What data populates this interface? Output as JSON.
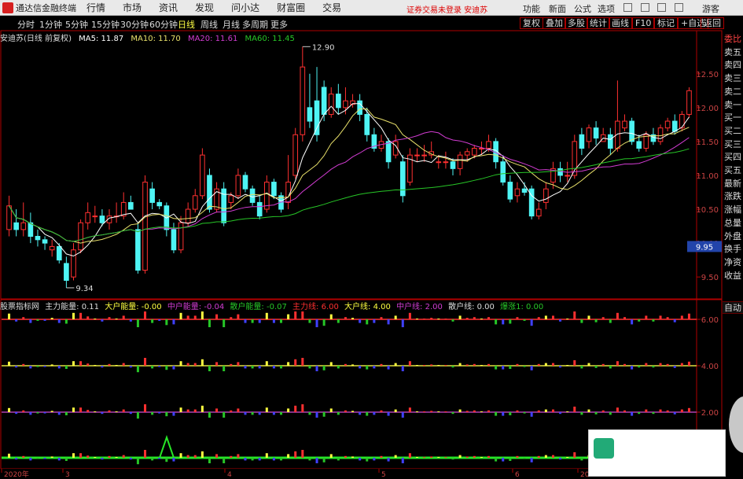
{
  "titlebar": {
    "app_name": "通达信金融终端",
    "menus": [
      "行情",
      "市场",
      "资讯",
      "发现",
      "问小达",
      "财富圈",
      "交易"
    ],
    "warning": "证券交易未登录 安迪苏",
    "right": [
      "功能",
      "新面",
      "公式",
      "选项"
    ],
    "guest": "游客"
  },
  "toolbar": {
    "periods": [
      "分时",
      "1分钟",
      "5分钟",
      "15分钟",
      "30分钟",
      "60分钟",
      "日线",
      "周线",
      "月线",
      "多周期",
      "更多"
    ],
    "active_period": "日线",
    "right_buttons": [
      "复权",
      "叠加",
      "多股",
      "统计",
      "画线",
      "F10",
      "标记",
      "+自选",
      "返回"
    ]
  },
  "infobar": {
    "stock": "安迪苏(日线 前复权)",
    "ma5": "MA5: 11.87",
    "ma10": "MA10: 11.70",
    "ma20": "MA20: 11.61",
    "ma60": "MA60: 11.45"
  },
  "colors": {
    "ma5": "#ffffff",
    "ma10": "#e8e06a",
    "ma20": "#d23cd2",
    "ma60": "#27c627",
    "up": "#ff3030",
    "down": "#4ef4f4",
    "frame": "#b00000"
  },
  "price_axis": {
    "ticks": [
      "12.50",
      "12.00",
      "11.50",
      "11.00",
      "10.50",
      "10.00",
      "9.50"
    ],
    "current": "9.95"
  },
  "annotations": {
    "high": "12.90",
    "low": "9.34"
  },
  "right_panel": [
    "委比",
    "卖五",
    "卖四",
    "卖三",
    "卖二",
    "卖一",
    "买一",
    "买二",
    "买三",
    "买四",
    "买五",
    "最新",
    "涨跌",
    "涨幅",
    "总量",
    "外盘",
    "换手",
    "净资",
    "收益"
  ],
  "auto_label": "自动",
  "sub_indicator": {
    "name": "股票指标网",
    "items": [
      {
        "label": "主力能量: 0.11",
        "color": "#dddddd"
      },
      {
        "label": "大户能量: -0.00",
        "color": "#ffff40"
      },
      {
        "label": "中户能量: -0.04",
        "color": "#d23cd2"
      },
      {
        "label": "散户能量: -0.07",
        "color": "#27c627"
      },
      {
        "label": "主力线: 6.00",
        "color": "#ff3030"
      },
      {
        "label": "大户线: 4.00",
        "color": "#ffff40"
      },
      {
        "label": "中户线: 2.00",
        "color": "#d23cd2"
      },
      {
        "label": "散户线: 0.00",
        "color": "#dddddd"
      },
      {
        "label": "爆涨1: 0.00",
        "color": "#27c627"
      }
    ]
  },
  "sub_axis": [
    "6.00",
    "4.00",
    "2.00"
  ],
  "time_axis": [
    "2020年",
    "3",
    "4",
    "5",
    "6",
    "20"
  ],
  "chart_data": {
    "type": "candlestick",
    "title": "安迪苏(日线 前复权)",
    "price_range": [
      9.2,
      12.95
    ],
    "candles": [
      [
        10.2,
        10.55,
        10.1,
        10.7
      ],
      [
        10.3,
        10.2,
        10.1,
        10.5
      ],
      [
        10.2,
        10.3,
        10.1,
        10.6
      ],
      [
        10.3,
        10.1,
        10.0,
        10.45
      ],
      [
        10.1,
        10.05,
        9.95,
        10.2
      ],
      [
        10.05,
        10.0,
        9.9,
        10.1
      ],
      [
        9.9,
        9.95,
        9.8,
        10.05
      ],
      [
        9.95,
        9.75,
        9.7,
        10.0
      ],
      [
        9.7,
        9.45,
        9.34,
        9.8
      ],
      [
        9.5,
        9.9,
        9.45,
        10.0
      ],
      [
        9.9,
        10.3,
        9.85,
        10.35
      ],
      [
        10.3,
        10.45,
        10.2,
        10.6
      ],
      [
        10.4,
        10.4,
        10.3,
        10.55
      ],
      [
        10.4,
        10.3,
        10.25,
        10.5
      ],
      [
        10.3,
        10.4,
        10.2,
        10.5
      ],
      [
        10.4,
        10.4,
        10.3,
        10.6
      ],
      [
        10.4,
        10.6,
        10.35,
        10.75
      ],
      [
        10.6,
        10.5,
        10.5,
        10.7
      ],
      [
        10.2,
        9.6,
        9.55,
        10.3
      ],
      [
        9.6,
        10.9,
        9.55,
        11.0
      ],
      [
        10.8,
        10.6,
        10.5,
        10.9
      ],
      [
        10.6,
        10.55,
        10.5,
        10.65
      ],
      [
        10.55,
        10.2,
        10.1,
        10.6
      ],
      [
        10.2,
        9.9,
        9.85,
        10.3
      ],
      [
        9.9,
        10.3,
        9.85,
        10.4
      ],
      [
        10.3,
        10.5,
        10.25,
        10.6
      ],
      [
        10.5,
        10.7,
        10.45,
        10.8
      ],
      [
        10.7,
        11.3,
        10.65,
        11.4
      ],
      [
        11.0,
        10.5,
        10.45,
        11.1
      ],
      [
        10.5,
        10.8,
        10.45,
        10.9
      ],
      [
        10.8,
        10.3,
        10.25,
        10.9
      ],
      [
        10.6,
        10.7,
        10.5,
        10.75
      ],
      [
        10.7,
        11.0,
        10.65,
        11.1
      ],
      [
        11.0,
        10.8,
        10.75,
        11.05
      ],
      [
        10.8,
        10.6,
        10.55,
        10.85
      ],
      [
        10.6,
        10.4,
        10.35,
        10.7
      ],
      [
        10.5,
        10.9,
        10.45,
        11.0
      ],
      [
        10.9,
        10.7,
        10.65,
        10.95
      ],
      [
        10.7,
        10.5,
        10.45,
        10.75
      ],
      [
        10.6,
        10.9,
        10.5,
        11.3
      ],
      [
        11.0,
        11.6,
        10.95,
        11.7
      ],
      [
        11.6,
        12.6,
        11.5,
        12.9
      ],
      [
        12.0,
        11.8,
        11.7,
        12.5
      ],
      [
        12.1,
        11.6,
        11.5,
        12.6
      ],
      [
        12.3,
        11.9,
        11.8,
        12.4
      ],
      [
        11.9,
        12.2,
        11.85,
        12.3
      ],
      [
        12.2,
        12.0,
        11.9,
        12.35
      ],
      [
        12.0,
        12.1,
        11.9,
        12.3
      ],
      [
        12.05,
        12.1,
        12.0,
        12.2
      ],
      [
        12.1,
        11.9,
        11.8,
        12.2
      ],
      [
        11.9,
        11.6,
        11.5,
        12.0
      ],
      [
        11.6,
        11.4,
        11.35,
        11.7
      ],
      [
        11.4,
        11.5,
        11.35,
        11.6
      ],
      [
        11.5,
        11.2,
        11.1,
        11.55
      ],
      [
        11.3,
        11.5,
        11.25,
        11.6
      ],
      [
        11.2,
        10.7,
        10.6,
        11.3
      ],
      [
        10.9,
        11.3,
        10.85,
        11.4
      ],
      [
        11.3,
        11.3,
        11.2,
        11.4
      ],
      [
        11.3,
        11.3,
        11.2,
        11.45
      ],
      [
        11.3,
        11.35,
        11.25,
        11.5
      ],
      [
        11.2,
        11.2,
        11.1,
        11.3
      ],
      [
        11.2,
        11.2,
        11.1,
        11.35
      ],
      [
        11.2,
        11.1,
        11.0,
        11.25
      ],
      [
        11.1,
        11.3,
        11.0,
        11.35
      ],
      [
        11.3,
        11.35,
        11.2,
        11.4
      ],
      [
        11.3,
        11.4,
        11.25,
        11.45
      ],
      [
        11.4,
        11.4,
        11.3,
        11.5
      ],
      [
        11.4,
        11.5,
        11.35,
        11.6
      ],
      [
        11.5,
        11.2,
        11.1,
        11.55
      ],
      [
        11.2,
        10.9,
        10.85,
        11.3
      ],
      [
        10.9,
        10.65,
        10.6,
        11.0
      ],
      [
        10.7,
        10.8,
        10.6,
        10.9
      ],
      [
        10.8,
        10.75,
        10.7,
        10.9
      ],
      [
        10.8,
        10.4,
        10.35,
        10.85
      ],
      [
        10.4,
        10.5,
        10.35,
        10.6
      ],
      [
        10.6,
        10.8,
        10.5,
        10.9
      ],
      [
        10.9,
        11.1,
        10.8,
        11.2
      ],
      [
        11.1,
        11.0,
        10.9,
        11.2
      ],
      [
        11.0,
        11.0,
        10.9,
        11.2
      ],
      [
        11.0,
        11.5,
        10.95,
        11.6
      ],
      [
        11.6,
        11.4,
        11.3,
        11.7
      ],
      [
        11.5,
        11.7,
        11.4,
        11.75
      ],
      [
        11.7,
        11.55,
        11.45,
        11.8
      ],
      [
        11.5,
        11.6,
        11.5,
        11.7
      ],
      [
        11.6,
        11.4,
        11.3,
        11.7
      ],
      [
        11.4,
        11.8,
        11.35,
        12.4
      ],
      [
        11.7,
        11.8,
        11.65,
        11.9
      ],
      [
        11.8,
        11.5,
        11.45,
        11.85
      ],
      [
        11.5,
        11.4,
        11.35,
        11.6
      ],
      [
        11.4,
        11.6,
        11.35,
        11.65
      ],
      [
        11.6,
        11.5,
        11.45,
        11.7
      ],
      [
        11.5,
        11.7,
        11.45,
        11.75
      ],
      [
        11.7,
        11.8,
        11.65,
        11.85
      ],
      [
        11.8,
        11.65,
        11.6,
        11.9
      ],
      [
        11.7,
        11.9,
        11.65,
        11.95
      ],
      [
        11.9,
        12.25,
        11.85,
        12.3
      ]
    ]
  }
}
